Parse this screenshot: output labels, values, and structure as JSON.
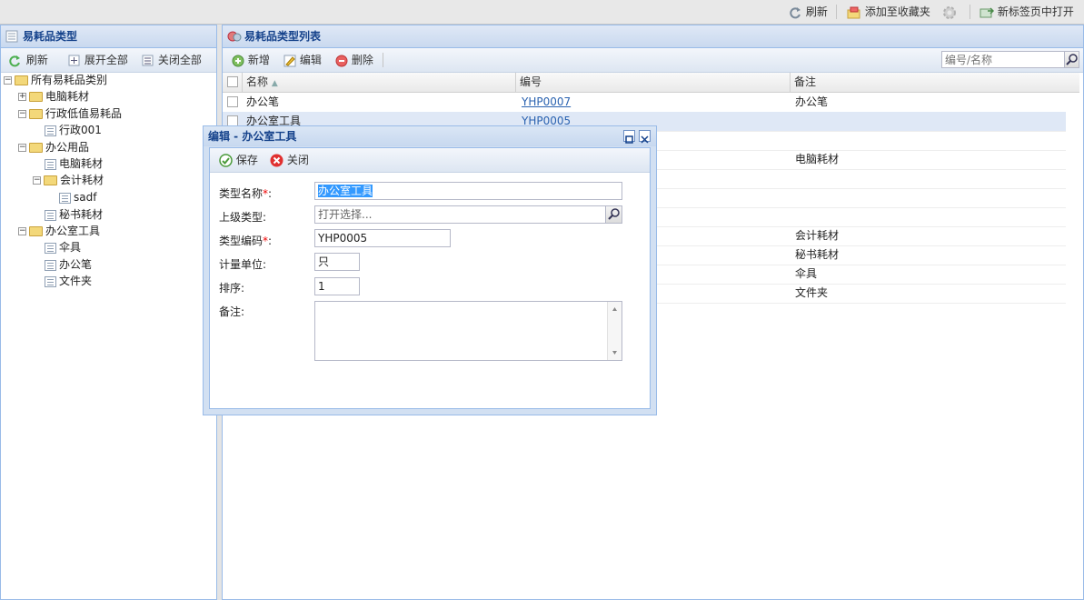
{
  "topbar": {
    "refresh": "刷新",
    "add_favorite": "添加至收藏夹",
    "open_new_tab": "新标签页中打开"
  },
  "left_panel": {
    "title": "易耗品类型",
    "toolbar": {
      "refresh": "刷新",
      "expand_all": "展开全部",
      "collapse_all": "关闭全部"
    },
    "tree": {
      "root": "所有易耗品类别",
      "n1": "电脑耗材",
      "n2": "行政低值易耗品",
      "n2_1": "行政001",
      "n3": "办公用品",
      "n3_1": "电脑耗材",
      "n3_2": "会计耗材",
      "n3_2_1": "sadf",
      "n3_3": "秘书耗材",
      "n4": "办公室工具",
      "n4_1": "伞具",
      "n4_2": "办公笔",
      "n4_3": "文件夹"
    }
  },
  "right_panel": {
    "title": "易耗品类型列表",
    "toolbar": {
      "add": "新增",
      "edit": "编辑",
      "delete": "删除"
    },
    "search_placeholder": "编号/名称",
    "columns": {
      "name": "名称",
      "code": "编号",
      "remark": "备注"
    },
    "rows": [
      {
        "name": "办公笔",
        "code": "YHP0007",
        "remark": "办公笔"
      },
      {
        "name": "办公室工具",
        "code": "YHP0005",
        "remark": ""
      },
      {
        "name": "",
        "code": "",
        "remark": ""
      },
      {
        "name": "",
        "code": "",
        "remark": "电脑耗材"
      },
      {
        "name": "",
        "code": "",
        "remark": ""
      },
      {
        "name": "",
        "code": "",
        "remark": ""
      },
      {
        "name": "",
        "code": "",
        "remark": ""
      },
      {
        "name": "",
        "code": "",
        "remark": "会计耗材"
      },
      {
        "name": "",
        "code": "",
        "remark": "秘书耗材"
      },
      {
        "name": "",
        "code": "",
        "remark": "伞具"
      },
      {
        "name": "",
        "code": "",
        "remark": "文件夹"
      }
    ]
  },
  "dialog": {
    "title": "编辑 - 办公室工具",
    "save": "保存",
    "close": "关闭",
    "fields": {
      "type_name_label": "类型名称",
      "type_name_value": "办公室工具",
      "parent_label": "上级类型:",
      "parent_placeholder": "打开选择...",
      "code_label": "类型编码",
      "code_value": "YHP0005",
      "unit_label": "计量单位:",
      "unit_value": "只",
      "sort_label": "排序:",
      "sort_value": "1",
      "remark_label": "备注:",
      "remark_value": "",
      "required_mark": "*",
      "colon": ":"
    }
  },
  "colors": {
    "header_text": "#15428b",
    "border": "#99bbe8",
    "link": "#2a62b0"
  }
}
